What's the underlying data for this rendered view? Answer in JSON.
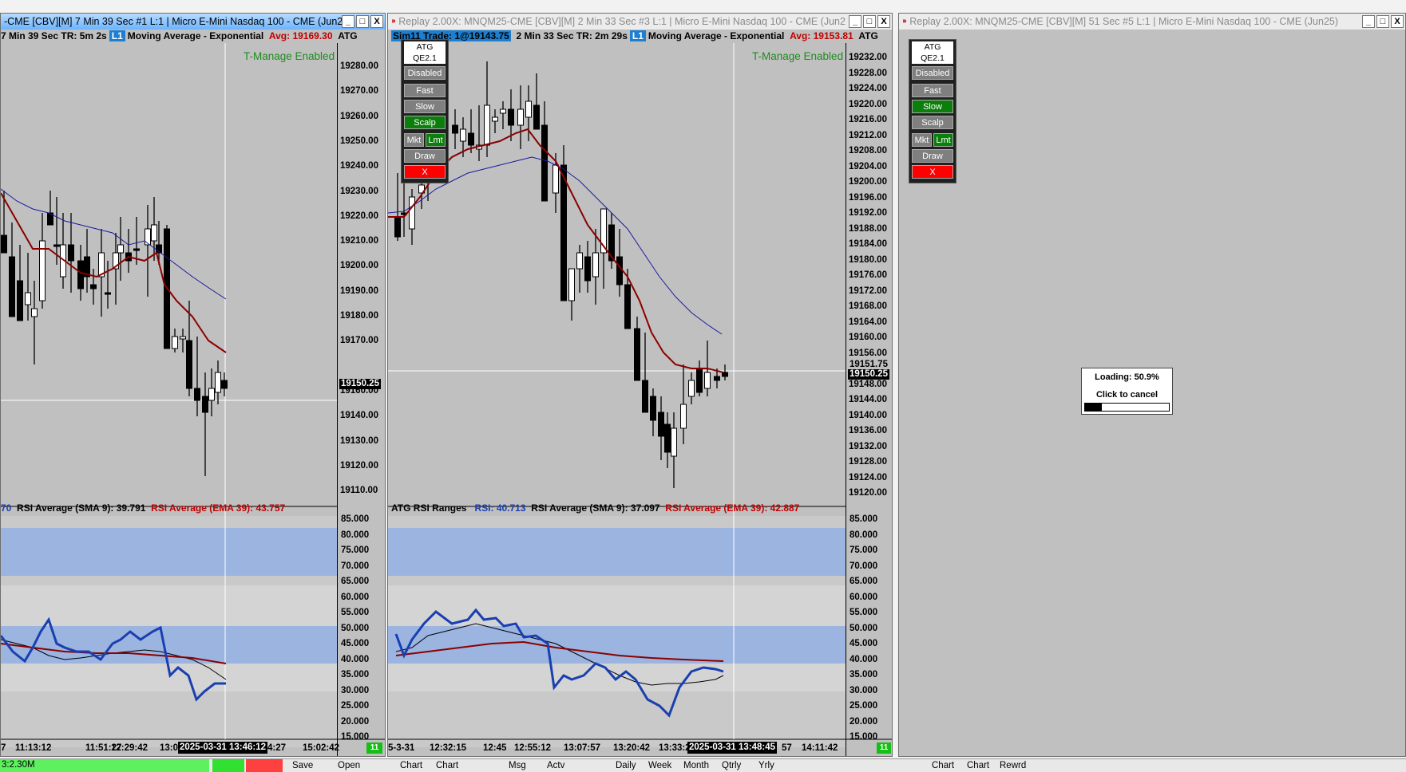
{
  "windows": [
    {
      "title": "-CME [CBV][M]  7 Min 39 Sec  #1 L:1  |  Micro E-Mini Nasdaq 100 - CME (Jun2",
      "header": {
        "left": "7 Min 39 Sec  TR: 5m 2s",
        "tag": "L1",
        "study": "Moving Average - Exponential",
        "avg": "Avg: 19169.30",
        "atg": "ATG"
      },
      "tmanage": "T-Manage Enabled",
      "price_labels": [
        "19280.00",
        "19270.00",
        "19260.00",
        "19250.00",
        "19240.00",
        "19230.00",
        "19220.00",
        "19210.00",
        "19200.00",
        "19190.00",
        "19180.00",
        "19170.00",
        "19160.00",
        "19140.00",
        "19130.00",
        "19120.00",
        "19110.00"
      ],
      "price_tag": "19150.25",
      "rsi_header": {
        "first": "70",
        "sma": "RSI Average (SMA 9): 39.791",
        "ema": "RSI Average (EMA 39): 43.757"
      },
      "rsi_labels": [
        "85.000",
        "80.000",
        "75.000",
        "70.000",
        "65.000",
        "60.000",
        "55.000",
        "50.000",
        "45.000",
        "40.000",
        "35.000",
        "30.000",
        "25.000",
        "20.000",
        "15.000"
      ],
      "time_labels": [
        "7",
        "11:13:12",
        "11:51:27",
        "12:29:42",
        "13:0",
        "4:27",
        "15:02:42"
      ],
      "time_stamp": "2025-03-31  13:46:12",
      "badge": "11"
    },
    {
      "title": "Replay 2.00X: MNQM25-CME [CBV][M]  2 Min 33 Sec  #3 L:1  |  Micro E-Mini Nasdaq 100 - CME (Jun2",
      "header": {
        "sim": "Sim11  Trade: 1@19143.75",
        "left": "2 Min 33 Sec  TR: 2m 29s",
        "tag": "L1",
        "study": "Moving Average - Exponential",
        "avg": "Avg: 19153.81",
        "atg": "ATG"
      },
      "tmanage": "T-Manage Enabled",
      "price_labels": [
        "19232.00",
        "19228.00",
        "19224.00",
        "19220.00",
        "19216.00",
        "19212.00",
        "19208.00",
        "19204.00",
        "19200.00",
        "19196.00",
        "19192.00",
        "19188.00",
        "19184.00",
        "19180.00",
        "19176.00",
        "19172.00",
        "19168.00",
        "19164.00",
        "19160.00",
        "19156.00",
        "19148.00",
        "19144.00",
        "19140.00",
        "19136.00",
        "19132.00",
        "19128.00",
        "19124.00",
        "19120.00"
      ],
      "price_top": "19151.75",
      "price_tag": "19150.25",
      "rsi_header": {
        "name": "ATG RSI Ranges",
        "rsi": "RSI: 40.713",
        "sma": "RSI Average (SMA 9): 37.097",
        "ema": "RSI Average (EMA 39): 42.887"
      },
      "rsi_labels": [
        "85.000",
        "80.000",
        "75.000",
        "70.000",
        "65.000",
        "60.000",
        "55.000",
        "50.000",
        "45.000",
        "40.000",
        "35.000",
        "30.000",
        "25.000",
        "20.000",
        "15.000"
      ],
      "time_labels": [
        "5-3-31",
        "12:32:15",
        "12:45",
        "12:55:12",
        "13:07:57",
        "13:20:42",
        "13:33:2",
        "57",
        "14:11:42"
      ],
      "time_stamp": "2025-03-31  13:48:45",
      "badge": "11"
    },
    {
      "title": "Replay 2.00X: MNQM25-CME [CBV][M]  51 Sec  #5 L:1  |  Micro E-Mini Nasdaq 100 - CME (Jun25)",
      "loading": {
        "text": "Loading: 50.9%",
        "cancel": "Click to cancel",
        "progress": 0.509
      }
    }
  ],
  "atg_panels": [
    {
      "title": "ATG QE2.1",
      "disabled": "Disabled",
      "fast": "Fast",
      "slow": "Slow",
      "scalp": "Scalp",
      "mkt": "Mkt",
      "lmt": "Lmt",
      "draw": "Draw",
      "x": "X",
      "active_speed": "scalp"
    },
    {
      "title": "ATG QE2.1",
      "disabled": "Disabled",
      "fast": "Fast",
      "slow": "Slow",
      "scalp": "Scalp",
      "mkt": "Mkt",
      "lmt": "Lmt",
      "draw": "Draw",
      "x": "X",
      "active_speed": "slow"
    }
  ],
  "window_buttons": {
    "minimize": "_",
    "maximize": "□",
    "close": "X"
  },
  "bottom_bar": {
    "status": "3:2.30M",
    "items": [
      "Save",
      "Open",
      "Chart",
      "Chart",
      "Msg",
      "Actv",
      "Daily",
      "Week",
      "Month",
      "Qtrly",
      "Yrly",
      "Chart",
      "Chart",
      "Rewrd"
    ]
  },
  "colors": {
    "ema_red": "#8b0000",
    "ema_blue": "#1a1aa0",
    "rsi_blue": "#1a3fb0",
    "band": "#9bb4e0",
    "active": "#0b7e0b"
  }
}
